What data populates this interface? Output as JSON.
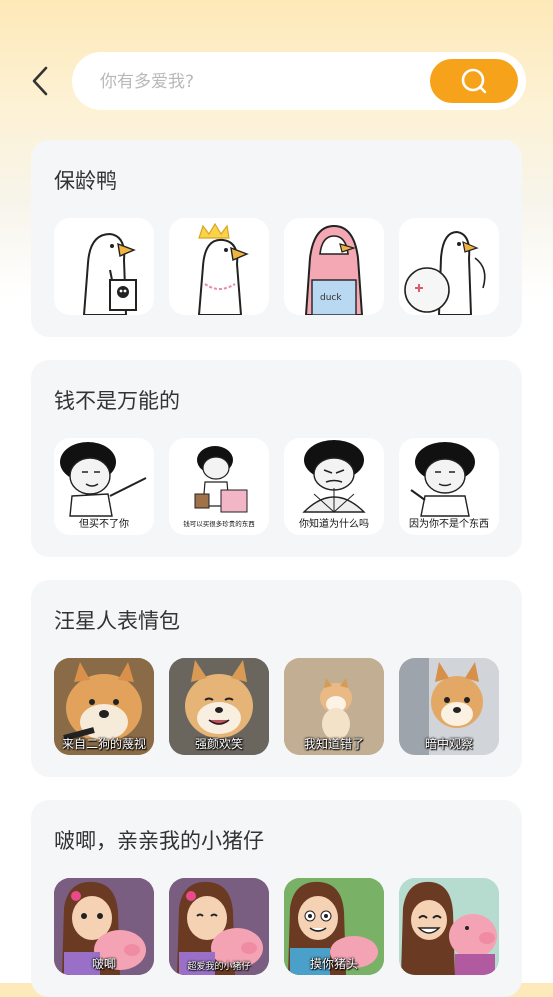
{
  "search": {
    "placeholder": "你有多爱我?"
  },
  "sections": [
    {
      "title": "保龄鸭",
      "stickers": [
        {
          "caption": ""
        },
        {
          "caption": ""
        },
        {
          "caption": ""
        },
        {
          "caption": ""
        }
      ]
    },
    {
      "title": "钱不是万能的",
      "stickers": [
        {
          "caption": "但买不了你"
        },
        {
          "caption": "钱可以买很多珍贵的东西"
        },
        {
          "caption": "你知道为什么吗"
        },
        {
          "caption": "因为你不是个东西"
        }
      ]
    },
    {
      "title": "汪星人表情包",
      "stickers": [
        {
          "caption": "来自二狗的蔑视"
        },
        {
          "caption": "强颜欢笑"
        },
        {
          "caption": "我知道错了"
        },
        {
          "caption": "暗中观察"
        }
      ]
    },
    {
      "title": "啵唧，亲亲我的小猪仔",
      "stickers": [
        {
          "caption": "啵唧"
        },
        {
          "caption": "超爱我的小猪仔"
        },
        {
          "caption": "摸你猪头"
        },
        {
          "caption": ""
        }
      ]
    }
  ],
  "icons": {
    "back": "chevron-left-icon",
    "search": "search-icon"
  },
  "colors": {
    "accent": "#f7a21b",
    "card": "#f5f6f8",
    "title": "#333333"
  }
}
